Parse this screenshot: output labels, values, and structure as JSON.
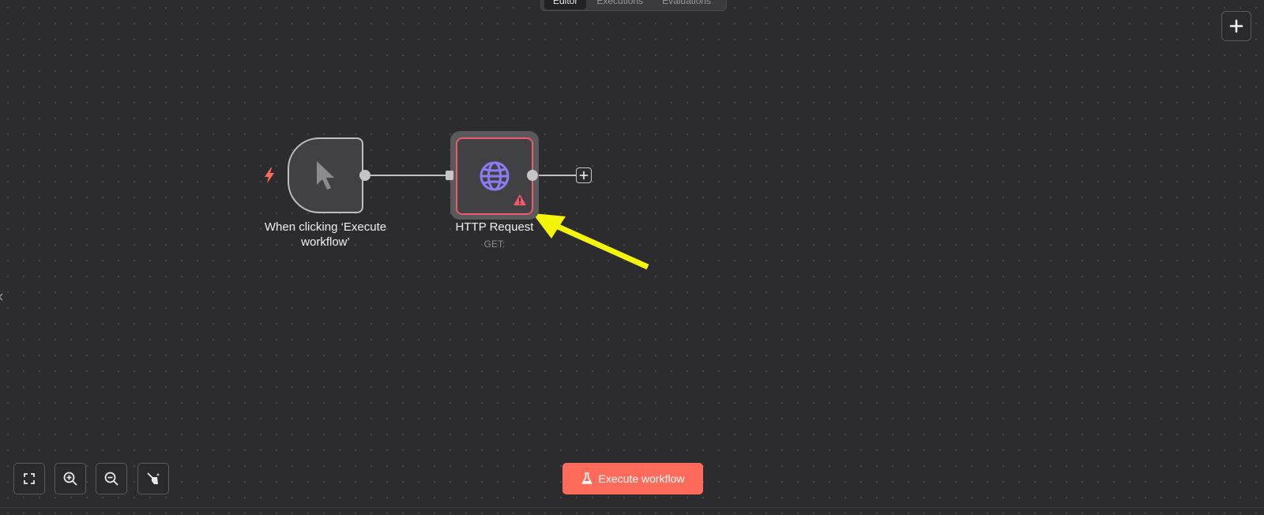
{
  "tabs": [
    {
      "label": "Editor",
      "active": true
    },
    {
      "label": "Executions",
      "active": false
    },
    {
      "label": "Evaluations",
      "active": false
    }
  ],
  "nodes": {
    "trigger": {
      "title": "When clicking ‘Execute workflow’",
      "icon": "pointer-cursor-icon",
      "badge_icon": "lightning-bolt-icon"
    },
    "http": {
      "title": "HTTP Request",
      "subtitle": "GET:",
      "icon": "globe-icon",
      "status_icon": "warning-triangle-icon",
      "status": "error"
    }
  },
  "toolbar": {
    "add_node_icon": "plus-icon",
    "controls": [
      "fit-view-icon",
      "zoom-in-icon",
      "zoom-out-icon",
      "tidy-up-icon"
    ],
    "execute_label": "Execute workflow",
    "execute_icon": "flask-icon"
  },
  "colors": {
    "canvas": "#2c2c2e",
    "accent": "#ff6b5a",
    "error": "#f05a6a",
    "globe": "#8b7cf6",
    "annotation_arrow": "#f5f50a"
  }
}
